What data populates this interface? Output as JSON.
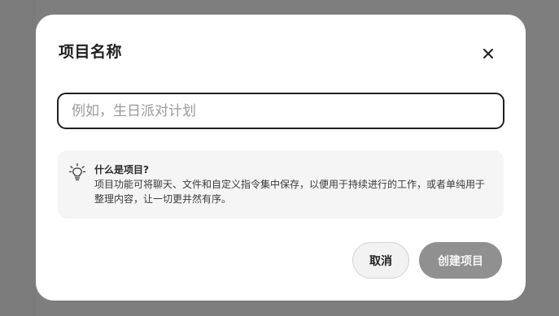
{
  "dialog": {
    "title": "项目名称",
    "close_icon": "close-icon",
    "input": {
      "value": "",
      "placeholder": "例如，生日派对计划"
    },
    "info": {
      "icon": "lightbulb-icon",
      "heading": "什么是项目?",
      "body": "项目功能可将聊天、文件和自定义指令集中保存，以便用于持续进行的工作，或者单纯用于整理内容，让一切更井然有序。"
    },
    "buttons": {
      "cancel_label": "取消",
      "create_label": "创建项目",
      "create_enabled": false
    }
  },
  "colors": {
    "backdrop": "#7e7e7e",
    "create_button_disabled": "#909090",
    "info_background": "#f5f5f5"
  }
}
